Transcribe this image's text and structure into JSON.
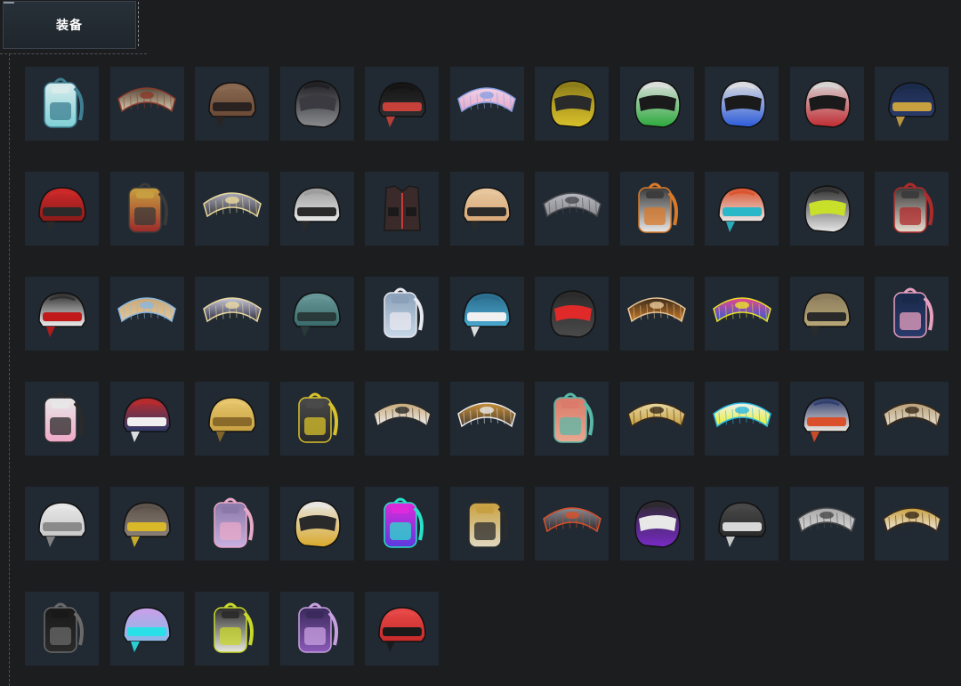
{
  "tab": {
    "label": "装备"
  },
  "colors": {
    "background": "#1c1d1f",
    "tile": "#212a33",
    "tab_bg": "#273038"
  },
  "items": [
    {
      "kind": "backpack",
      "icon": "backpack-icon",
      "colors": [
        "#7fd0d6",
        "#3f7f92",
        "#d9ecec"
      ]
    },
    {
      "kind": "glider",
      "icon": "glider-icon",
      "colors": [
        "#d9cbb2",
        "#8a3a2a",
        "#5a4a3a"
      ]
    },
    {
      "kind": "helmet",
      "icon": "leather-helmet-icon",
      "colors": [
        "#6b4a36",
        "#2a2220",
        "#8a6a52"
      ]
    },
    {
      "kind": "fullhelmet",
      "icon": "full-face-helmet-icon",
      "colors": [
        "#8a8c90",
        "#3a3a40",
        "#1e1e22"
      ]
    },
    {
      "kind": "helmet",
      "icon": "tactical-helmet-icon",
      "colors": [
        "#2e2e30",
        "#c8403a",
        "#141414"
      ]
    },
    {
      "kind": "glider",
      "icon": "glider-icon",
      "colors": [
        "#e6a8c8",
        "#8aa0e0",
        "#f0d0e8"
      ]
    },
    {
      "kind": "fullhelmet",
      "icon": "yellow-moto-helmet-icon",
      "colors": [
        "#d9c12a",
        "#2a2a2a",
        "#8a7a1a"
      ]
    },
    {
      "kind": "fullhelmet",
      "icon": "green-moto-helmet-icon",
      "colors": [
        "#2aa83a",
        "#1a1a1a",
        "#e0e0e0"
      ]
    },
    {
      "kind": "fullhelmet",
      "icon": "blue-moto-helmet-icon",
      "colors": [
        "#2a5ad9",
        "#1a1a1a",
        "#e0e0e0"
      ]
    },
    {
      "kind": "fullhelmet",
      "icon": "red-moto-helmet-icon",
      "colors": [
        "#c02a30",
        "#1a1a1a",
        "#d8d8d8"
      ]
    },
    {
      "kind": "helmet",
      "icon": "navy-gold-helmet-icon",
      "colors": [
        "#2a3a6a",
        "#c8a040",
        "#1a2a4a"
      ]
    },
    {
      "kind": "helmet",
      "icon": "red-horned-helmet-icon",
      "colors": [
        "#8a1a1a",
        "#2a2a2a",
        "#d02a2a"
      ]
    },
    {
      "kind": "backpack",
      "icon": "red-backpack-icon",
      "colors": [
        "#9a2a2a",
        "#3a3a3a",
        "#c8a040"
      ]
    },
    {
      "kind": "glider",
      "icon": "glider-icon",
      "colors": [
        "#3a3a40",
        "#e8d89a",
        "#a8a8b8"
      ]
    },
    {
      "kind": "helmet",
      "icon": "white-winged-helmet-icon",
      "colors": [
        "#e8e8e8",
        "#2a2a2a",
        "#9a9a9a"
      ]
    },
    {
      "kind": "vest",
      "icon": "vest-icon",
      "colors": [
        "#3a2a2a",
        "#c83a3a",
        "#1a1a1a"
      ]
    },
    {
      "kind": "helmet",
      "icon": "orange-patterned-helmet-icon",
      "colors": [
        "#d9a878",
        "#2a2a2a",
        "#e8c8a0"
      ]
    },
    {
      "kind": "glider",
      "icon": "glider-icon",
      "colors": [
        "#8a8a90",
        "#4a4a50",
        "#b8b8c0"
      ]
    },
    {
      "kind": "backpack",
      "icon": "white-backpack-icon",
      "colors": [
        "#e8e8e8",
        "#d97a2a",
        "#3a3a3a"
      ]
    },
    {
      "kind": "helmet",
      "icon": "visor-helmet-icon",
      "colors": [
        "#e8e8e8",
        "#2ab8c8",
        "#d9502a"
      ]
    },
    {
      "kind": "fullhelmet",
      "icon": "motocross-helmet-icon",
      "colors": [
        "#e8e8e8",
        "#c8e02a",
        "#2a2a2a"
      ]
    },
    {
      "kind": "backpack",
      "icon": "christmas-backpack-icon",
      "colors": [
        "#e8dcd0",
        "#b02a2a",
        "#3a3a3a"
      ]
    },
    {
      "kind": "helmet",
      "icon": "top-hat-helmet-icon",
      "colors": [
        "#f0f0f0",
        "#c01a1a",
        "#2a2a2a"
      ]
    },
    {
      "kind": "glider",
      "icon": "glider-icon",
      "colors": [
        "#e8c89a",
        "#8ab8e0",
        "#c8a878"
      ]
    },
    {
      "kind": "glider",
      "icon": "glider-icon",
      "colors": [
        "#2a2a40",
        "#e8d8a0",
        "#c8c8d8"
      ]
    },
    {
      "kind": "helmet",
      "icon": "camo-helmet-icon",
      "colors": [
        "#3a6a6a",
        "#2a3a3a",
        "#6a9a9a"
      ]
    },
    {
      "kind": "backpack",
      "icon": "shark-backpack-icon",
      "colors": [
        "#c8d8e8",
        "#e8e8f0",
        "#8aa0b8"
      ]
    },
    {
      "kind": "helmet",
      "icon": "shark-helmet-icon",
      "colors": [
        "#4aa8d0",
        "#f0f0f0",
        "#2a6a8a"
      ]
    },
    {
      "kind": "fullhelmet",
      "icon": "red-visor-helmet-icon",
      "colors": [
        "#4a4a4a",
        "#e02a2a",
        "#2a2a2a"
      ]
    },
    {
      "kind": "glider",
      "icon": "glider-icon",
      "colors": [
        "#c87a2a",
        "#e8c89a",
        "#3a2a1a"
      ]
    },
    {
      "kind": "glider",
      "icon": "glider-icon",
      "colors": [
        "#2a5ad9",
        "#e8e02a",
        "#e84a8a"
      ]
    },
    {
      "kind": "helmet",
      "icon": "gold-helmet-icon",
      "colors": [
        "#b8a878",
        "#2a2a2a",
        "#8a7a5a"
      ]
    },
    {
      "kind": "backpack",
      "icon": "navy-backpack-icon",
      "colors": [
        "#2a3a6a",
        "#e8a0c0",
        "#1a2a4a"
      ]
    },
    {
      "kind": "backpack",
      "icon": "pink-backpack-icon",
      "colors": [
        "#f0a8c8",
        "#2a2a2a",
        "#e8e8e8"
      ]
    },
    {
      "kind": "helmet",
      "icon": "striped-helmet-icon",
      "colors": [
        "#2a3a6a",
        "#f0f0f0",
        "#c02a2a"
      ]
    },
    {
      "kind": "helmet",
      "icon": "gold-winged-helmet-icon",
      "colors": [
        "#c8a040",
        "#8a6a2a",
        "#e8c870"
      ]
    },
    {
      "kind": "backpack",
      "icon": "black-yellow-backpack-icon",
      "colors": [
        "#2a2a2a",
        "#d9c12a",
        "#4a4a4a"
      ]
    },
    {
      "kind": "glider",
      "icon": "glider-icon",
      "colors": [
        "#f0f0f0",
        "#2a2a2a",
        "#c8a878"
      ]
    },
    {
      "kind": "glider",
      "icon": "glider-icon",
      "colors": [
        "#4a3a2a",
        "#e8e8e8",
        "#c8903a"
      ]
    },
    {
      "kind": "backpack",
      "icon": "floral-backpack-icon",
      "colors": [
        "#e8a890",
        "#5ab8a8",
        "#d97a6a"
      ]
    },
    {
      "kind": "glider",
      "icon": "glider-icon",
      "colors": [
        "#c8a040",
        "#3a2a1a",
        "#e8d8a0"
      ]
    },
    {
      "kind": "glider",
      "icon": "glider-icon",
      "colors": [
        "#e8f02a",
        "#2ab8e0",
        "#f0f0f0"
      ]
    },
    {
      "kind": "helmet",
      "icon": "anchor-helmet-icon",
      "colors": [
        "#f0e8e0",
        "#d9502a",
        "#2a3a6a"
      ]
    },
    {
      "kind": "glider",
      "icon": "glider-icon",
      "colors": [
        "#e8e0d0",
        "#3a2a1a",
        "#b8a078"
      ]
    },
    {
      "kind": "helmet",
      "icon": "viking-helmet-icon",
      "colors": [
        "#c8c8c8",
        "#8a8a8a",
        "#e8e8e8"
      ]
    },
    {
      "kind": "helmet",
      "icon": "star-helmet-icon",
      "colors": [
        "#8a8078",
        "#d9b82a",
        "#5a5048"
      ]
    },
    {
      "kind": "backpack",
      "icon": "lavender-backpack-icon",
      "colors": [
        "#c8b0e0",
        "#e8a8c8",
        "#8a78a8"
      ]
    },
    {
      "kind": "fullhelmet",
      "icon": "cat-helmet-icon",
      "colors": [
        "#d9a82a",
        "#2a2a2a",
        "#e8e8e8"
      ]
    },
    {
      "kind": "backpack",
      "icon": "neon-backpack-icon",
      "colors": [
        "#5a3ae0",
        "#2ae0c8",
        "#e02ad9"
      ]
    },
    {
      "kind": "backpack",
      "icon": "beige-backpack-icon",
      "colors": [
        "#e0d8c0",
        "#2a2a2a",
        "#c8a040"
      ]
    },
    {
      "kind": "glider",
      "icon": "glider-icon",
      "colors": [
        "#2a2a30",
        "#d9502a",
        "#8a8a90"
      ]
    },
    {
      "kind": "fullhelmet",
      "icon": "purple-helmet-icon",
      "colors": [
        "#7a2ac8",
        "#e8e8e8",
        "#2a2a2a"
      ]
    },
    {
      "kind": "helmet",
      "icon": "black-bull-helmet-icon",
      "colors": [
        "#2a2a2a",
        "#d8d8d8",
        "#4a4a4a"
      ]
    },
    {
      "kind": "glider",
      "icon": "glider-icon",
      "colors": [
        "#d8d8d8",
        "#4a4a4a",
        "#a8a8a8"
      ]
    },
    {
      "kind": "glider",
      "icon": "glider-icon",
      "colors": [
        "#f0e8d8",
        "#3a2a1a",
        "#c8a040"
      ]
    },
    {
      "kind": "backpack",
      "icon": "studded-backpack-icon",
      "colors": [
        "#2a2a2a",
        "#6a6a6a",
        "#1a1a1a"
      ]
    },
    {
      "kind": "helmet",
      "icon": "holographic-helmet-icon",
      "colors": [
        "#8ab8e8",
        "#2ae0e8",
        "#c8a0e8"
      ]
    },
    {
      "kind": "backpack",
      "icon": "graffiti-backpack-icon",
      "colors": [
        "#e8e8e0",
        "#c8d82a",
        "#2a2a2a"
      ]
    },
    {
      "kind": "backpack",
      "icon": "purple-pattern-backpack-icon",
      "colors": [
        "#8a5ab8",
        "#c8a0e0",
        "#3a2a5a"
      ]
    },
    {
      "kind": "helmet",
      "icon": "plaid-helmet-icon",
      "colors": [
        "#c82a2a",
        "#1a1a1a",
        "#e84a4a"
      ]
    }
  ]
}
